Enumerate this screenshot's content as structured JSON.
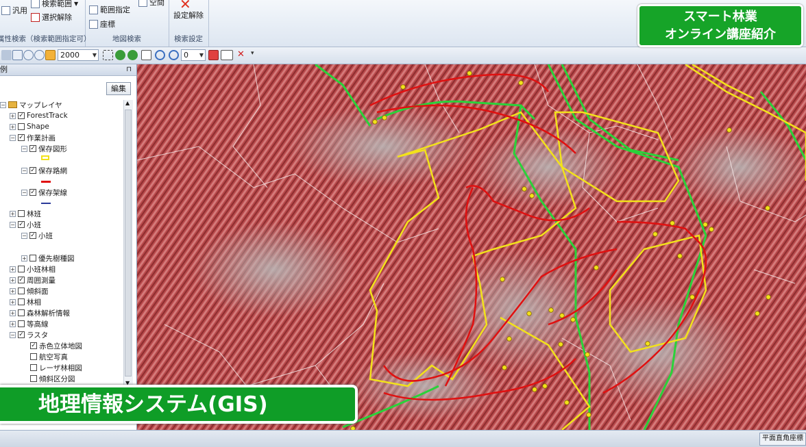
{
  "ribbon": {
    "general_label": "汎用",
    "search_range_label": "検索範囲",
    "deselect_label": "選択解除",
    "attr_group_label": "属性検索（検索範囲指定可）",
    "range_spec_label": "範囲指定",
    "coords_label": "座標",
    "space_label": "空間",
    "map_group_label": "地図検索",
    "clear_settings_label": "設定解除",
    "search_settings_label": "検索設定"
  },
  "toolbar": {
    "scale_value": "2000",
    "angle_value": "0"
  },
  "legend": {
    "title": "例",
    "edit_label": "編集",
    "items": [
      {
        "label": "マップレイヤ",
        "checked": null
      },
      {
        "label": "ForestTrack",
        "checked": true
      },
      {
        "label": "Shape",
        "checked": false
      },
      {
        "label": "作業計画",
        "checked": true
      },
      {
        "label": "保存図形",
        "checked": true
      },
      {
        "label": "保存路網",
        "checked": true
      },
      {
        "label": "保存架線",
        "checked": true
      },
      {
        "label": "林班",
        "checked": false
      },
      {
        "label": "小班",
        "checked": true
      },
      {
        "label": "小班",
        "checked": true
      },
      {
        "label": "優先樹種図",
        "checked": false
      },
      {
        "label": "小班林相",
        "checked": false
      },
      {
        "label": "周囲測量",
        "checked": true
      },
      {
        "label": "傾斜面",
        "checked": false
      },
      {
        "label": "林相",
        "checked": false
      },
      {
        "label": "森林解析情報",
        "checked": false
      },
      {
        "label": "等高線",
        "checked": false
      },
      {
        "label": "ラスタ",
        "checked": true
      },
      {
        "label": "赤色立体地図",
        "checked": true
      },
      {
        "label": "航空写真",
        "checked": false
      },
      {
        "label": "レーザ林相図",
        "checked": false
      },
      {
        "label": "傾斜区分図",
        "checked": false
      }
    ]
  },
  "overlay": {
    "title_line1": "スマート林業",
    "title_line2": "オンライン講座紹介",
    "banner": "地理情報システム(GIS)"
  },
  "status": {
    "coord_system": "平面直角座標"
  },
  "colors": {
    "track_red": "#e01010",
    "work_yellow": "#f2e21a",
    "road_green": "#2ad23a",
    "banner_green": "#0f9d27"
  }
}
